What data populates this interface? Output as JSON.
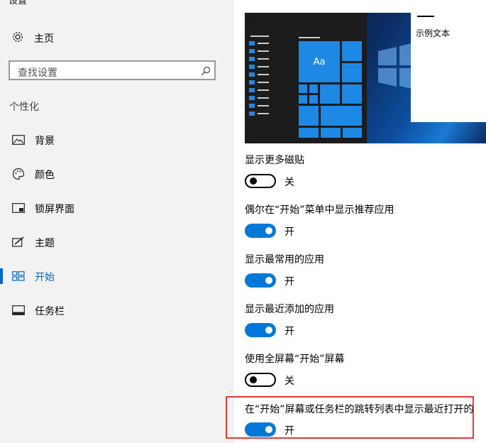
{
  "app": {
    "title": "设置"
  },
  "sidebar": {
    "home_label": "主页",
    "search_placeholder": "查找设置",
    "section_title": "个性化",
    "items": [
      {
        "label": "背景",
        "icon": "picture-icon",
        "active": false
      },
      {
        "label": "颜色",
        "icon": "palette-icon",
        "active": false
      },
      {
        "label": "锁屏界面",
        "icon": "lock-screen-icon",
        "active": false
      },
      {
        "label": "主题",
        "icon": "theme-brush-icon",
        "active": false
      },
      {
        "label": "开始",
        "icon": "start-tiles-icon",
        "active": true
      },
      {
        "label": "任务栏",
        "icon": "taskbar-icon",
        "active": false
      }
    ]
  },
  "preview": {
    "tile_text": "Aa",
    "sample_text": "示例文本"
  },
  "options": [
    {
      "label": "显示更多磁贴",
      "state": "关",
      "on": false
    },
    {
      "label": "偶尔在“开始”菜单中显示推荐应用",
      "state": "开",
      "on": true
    },
    {
      "label": "显示最常用的应用",
      "state": "开",
      "on": true
    },
    {
      "label": "显示最近添加的应用",
      "state": "开",
      "on": true
    },
    {
      "label": "使用全屏幕“开始”屏幕",
      "state": "关",
      "on": false
    },
    {
      "label": "在“开始”屏幕或任务栏的跳转列表中显示最近打开的",
      "state": "开",
      "on": true
    }
  ],
  "colors": {
    "accent": "#0078d7",
    "highlight": "#e53935"
  }
}
